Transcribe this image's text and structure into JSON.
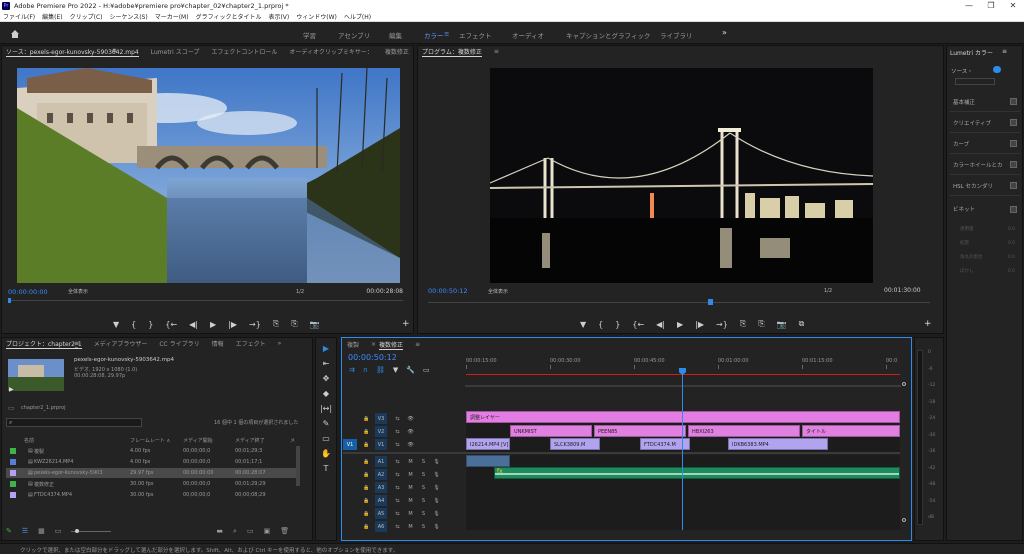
{
  "window": {
    "title": "Adobe Premiere Pro 2022 - H:¥adobe¥premiere pro¥chapter_02¥chapter2_1.prproj *",
    "icon": "Pr",
    "controls": [
      "—",
      "❐",
      "✕"
    ]
  },
  "menu": [
    "ファイル(F)",
    "編集(E)",
    "クリップ(C)",
    "シーケンス(S)",
    "マーカー(M)",
    "グラフィックとタイトル",
    "表示(V)",
    "ウィンドウ(W)",
    "ヘルプ(H)"
  ],
  "workspaces": {
    "items": [
      "学習",
      "アセンブリ",
      "編集",
      "カラー",
      "エフェクト",
      "オーディオ",
      "キャプションとグラフィック",
      "ライブラリ"
    ],
    "active_menu": "≡",
    "more": "»"
  },
  "source": {
    "tabs": [
      "ソース：pexels-egor-kunovsky-5903642.mp4",
      "Lumetri スコープ",
      "エフェクトコントロール",
      "オーディオクリップミキサー：",
      "複数修正"
    ],
    "menu": "≡",
    "more": "»",
    "timecode": "00:00:00:00",
    "fit": "全体表示",
    "fraction": "1/2",
    "duration": "00:00:28:08",
    "buttons": [
      "▼",
      "{",
      "}",
      "{←",
      "◀|",
      "▶",
      "|▶",
      "→}",
      "⎘",
      "⎘",
      "📷"
    ],
    "add": "+"
  },
  "program": {
    "tabs": [
      "プログラム：複数修正"
    ],
    "menu": "≡",
    "timecode": "00:00:50:12",
    "fit": "全体表示",
    "fraction": "1/2",
    "duration": "00:01:30:00",
    "buttons": [
      "▼",
      "{",
      "}",
      "{←",
      "◀|",
      "▶",
      "|▶",
      "→}",
      "⎘",
      "⎘",
      "📷",
      "⧉"
    ],
    "add": "+"
  },
  "project": {
    "tabs": [
      "プロジェクト：chapter2_1",
      "メディアブラウザー",
      "CC ライブラリ",
      "情報",
      "エフェクト"
    ],
    "menu": "≡",
    "more": "»",
    "thumb_name": "pexels-egor-kunovsky-5903642.mp4",
    "thumb_info1": "ビデオ, 1920 x 1080 (1.0)",
    "thumb_info2": "00:00:28:08, 29.97p",
    "path": "chapter2_1.prproj",
    "selection_info": "16 個中 1 個の項目が選択されました",
    "columns": [
      "名前",
      "フレームレート ∧",
      "メディア開始",
      "メディア終了",
      "メ"
    ],
    "rows": [
      {
        "color": "#3fb24a",
        "name": "複製",
        "fps": "4.00 fps",
        "start": "00;00;00;0",
        "end": "00;01;29;3"
      },
      {
        "color": "#5b7bd8",
        "name": "KWZ26214.MP4",
        "fps": "4.00 fps",
        "start": "00;00;00;0",
        "end": "00;01;17;1"
      },
      {
        "color": "#b6a0f0",
        "name": "pexels-egor-kunovsky-5903",
        "fps": "29.97 fps",
        "start": "00:00:00:00",
        "end": "00:00:28:07"
      },
      {
        "color": "#3fb24a",
        "name": "複数修正",
        "fps": "30.00 fps",
        "start": "00;00;00;0",
        "end": "00;01;29;29"
      },
      {
        "color": "#b6a0f0",
        "name": "FTDC4374.MP4",
        "fps": "30.00 fps",
        "start": "00;00;00;0",
        "end": "00;00;08;29"
      }
    ]
  },
  "tools": [
    "▶",
    "⇤",
    "✥",
    "◆",
    "|↔|",
    "✎",
    "▭",
    "✋",
    "T"
  ],
  "timeline": {
    "tabs": [
      "複製",
      "複数修正"
    ],
    "close": "×",
    "menu": "≡",
    "timecode": "00:00:50:12",
    "ruler": [
      "00:00:15:00",
      "00:00:30:00",
      "00:00:45:00",
      "00:01:00:00",
      "00:01:15:00",
      "00:0"
    ],
    "video_tracks": [
      {
        "name": "V3",
        "src": ""
      },
      {
        "name": "V2",
        "src": ""
      },
      {
        "name": "V1",
        "src": "V1"
      }
    ],
    "audio_tracks": [
      {
        "name": "A1"
      },
      {
        "name": "A2"
      },
      {
        "name": "A3"
      },
      {
        "name": "A4"
      },
      {
        "name": "A5"
      },
      {
        "name": "A6"
      }
    ],
    "track_icons": {
      "lock": "🔒",
      "sync": "⇆",
      "eye": "👁",
      "mute": "M",
      "solo": "S",
      "voice": "🎙"
    },
    "clips": {
      "adjust": "調整レイヤー",
      "v2": [
        "UNKMIST",
        "PEEN85",
        "HBXI263",
        "タイトル"
      ],
      "v1": [
        "I26214.MP4 [V]",
        "SLCK3809.M",
        "FTDC4374.M",
        "IDKB6383.MP4"
      ],
      "fx": "fx"
    }
  },
  "meter_labels": [
    "0",
    "-6",
    "-12",
    "-18",
    "-24",
    "-30",
    "-36",
    "-42",
    "-48",
    "-54",
    "dB"
  ],
  "lumetri": {
    "title": "Lumetri カラー",
    "menu": "≡",
    "source_label": "ソース・",
    "sections": [
      "基本補正",
      "クリエイティブ",
      "カーブ",
      "カラーホイールとカ",
      "HSL セカンダリ",
      "ビネット"
    ],
    "vignette": [
      {
        "label": "適用量",
        "value": "0.0"
      },
      {
        "label": "拡張",
        "value": "0.0"
      },
      {
        "label": "角丸の割合",
        "value": "0.0"
      },
      {
        "label": "ぼかし",
        "value": "0.0"
      }
    ]
  },
  "statusbar": "クリックで選択、または空白部分をドラッグして選んだ部分を選択します。Shift、Alt、および Ctrl キーを使用すると、他のオプションを使用できます。",
  "colors": {
    "accent": "#2d8ceb",
    "adjust": "#e37de3",
    "v2clip": "#e080e0",
    "v1clip": "#b2a3ef",
    "audio": "#1f8a5e",
    "playhead": "#2d8ceb",
    "workarea": "#d41c1c"
  }
}
